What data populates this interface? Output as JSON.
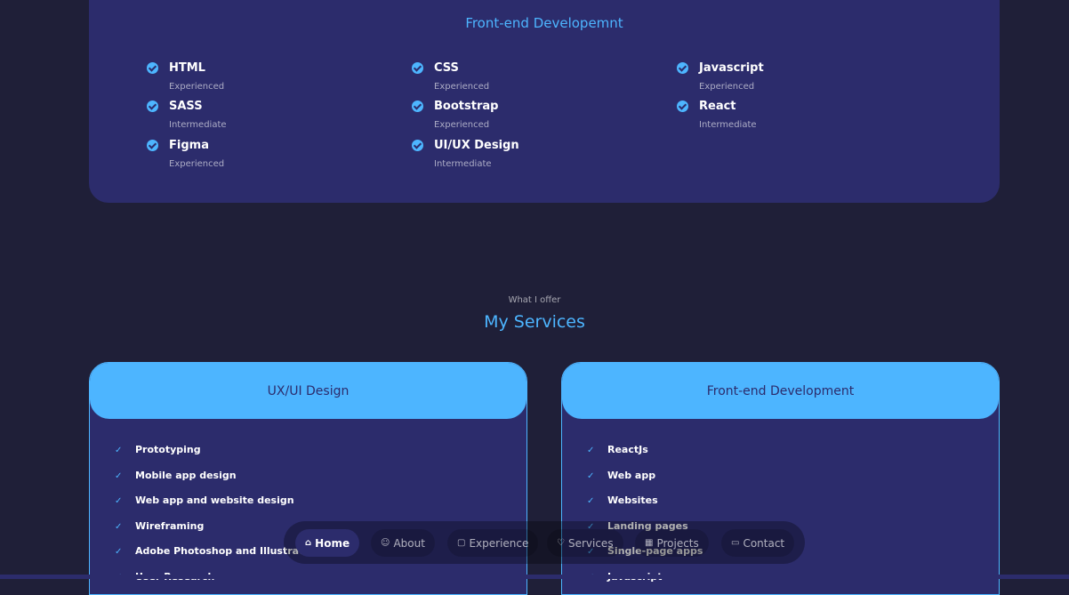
{
  "skills": {
    "title": "Front-end Developemnt",
    "items": [
      {
        "name": "HTML",
        "level": "Experienced"
      },
      {
        "name": "CSS",
        "level": "Experienced"
      },
      {
        "name": "Javascript",
        "level": "Experienced"
      },
      {
        "name": "SASS",
        "level": "Intermediate"
      },
      {
        "name": "Bootstrap",
        "level": "Experienced"
      },
      {
        "name": "React",
        "level": "Intermediate"
      },
      {
        "name": "Figma",
        "level": "Experienced"
      },
      {
        "name": "UI/UX Design",
        "level": "Intermediate"
      }
    ]
  },
  "services": {
    "subtitle": "What I offer",
    "title": "My Services",
    "cards": [
      {
        "title": "UX/UI Design",
        "items": [
          "Prototyping",
          "Mobile app design",
          "Web app and website design",
          "Wireframing",
          "Adobe Photoshop and Illustrator",
          "User Research"
        ]
      },
      {
        "title": "Front-end Development",
        "items": [
          "ReactJs",
          "Web app",
          "Websites",
          "Landing pages",
          "Single-page apps",
          "Javascript"
        ]
      }
    ]
  },
  "nav": {
    "items": [
      {
        "label": "Home",
        "icon": "home-icon",
        "active": true
      },
      {
        "label": "About",
        "icon": "user-icon",
        "active": false
      },
      {
        "label": "Experience",
        "icon": "briefcase-icon",
        "active": false
      },
      {
        "label": "Services",
        "icon": "handshake-icon",
        "active": false
      },
      {
        "label": "Projects",
        "icon": "projects-icon",
        "active": false
      },
      {
        "label": "Contact",
        "icon": "chat-icon",
        "active": false
      }
    ]
  },
  "colors": {
    "background": "#1f1f38",
    "card": "#2c2c6c",
    "accent": "#4db5ff"
  }
}
